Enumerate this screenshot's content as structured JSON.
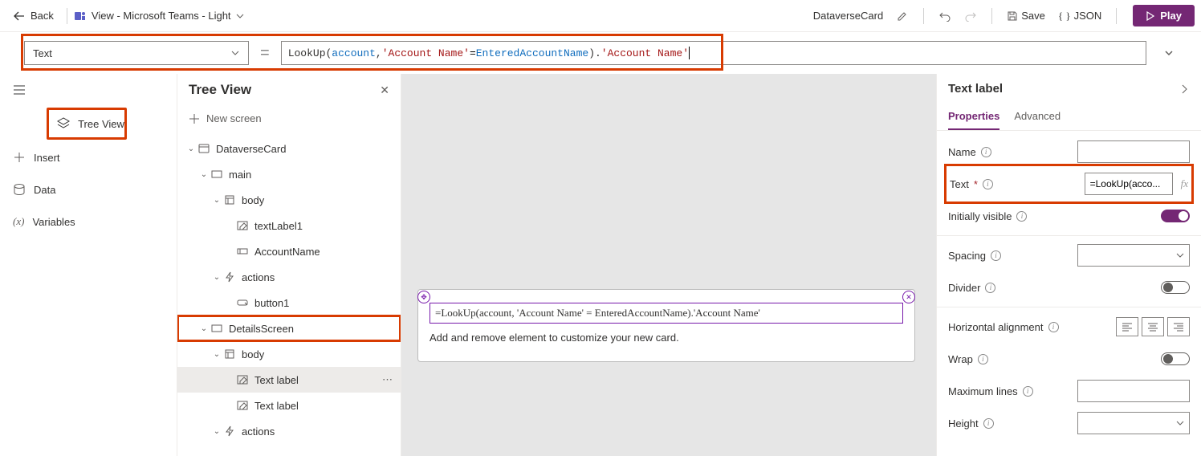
{
  "topbar": {
    "back": "Back",
    "view_label": "View - Microsoft Teams - Light",
    "tab_name": "DataverseCard",
    "save": "Save",
    "json": "JSON",
    "play": "Play"
  },
  "formula": {
    "selected_property": "Text",
    "expression_display": "LookUp(account, 'Account Name' = EnteredAccountName).'Account Name'",
    "tokens": {
      "t1": "LookUp(",
      "t2": "account",
      "t3": ", ",
      "t4": "'Account Name'",
      "t5": " = ",
      "t6": "EnteredAccountName",
      "t7": ").",
      "t8": "'Account Name'"
    }
  },
  "rail": {
    "tree": "Tree View",
    "insert": "Insert",
    "data": "Data",
    "variables": "Variables"
  },
  "tree": {
    "title": "Tree View",
    "new_screen": "New screen",
    "items": [
      {
        "label": "DataverseCard",
        "indent": 0,
        "icon": "card",
        "chev": true
      },
      {
        "label": "main",
        "indent": 1,
        "icon": "rect",
        "chev": true
      },
      {
        "label": "body",
        "indent": 2,
        "icon": "body",
        "chev": true
      },
      {
        "label": "textLabel1",
        "indent": 3,
        "icon": "textedit",
        "chev": false
      },
      {
        "label": "AccountName",
        "indent": 3,
        "icon": "input",
        "chev": false
      },
      {
        "label": "actions",
        "indent": 2,
        "icon": "bolt",
        "chev": true
      },
      {
        "label": "button1",
        "indent": 3,
        "icon": "button",
        "chev": false
      },
      {
        "label": "DetailsScreen",
        "indent": 1,
        "icon": "rect",
        "chev": true,
        "hl": true
      },
      {
        "label": "body",
        "indent": 2,
        "icon": "body",
        "chev": true
      },
      {
        "label": "Text label",
        "indent": 3,
        "icon": "textedit",
        "chev": false,
        "selected": true
      },
      {
        "label": "Text label",
        "indent": 3,
        "icon": "textedit",
        "chev": false
      },
      {
        "label": "actions",
        "indent": 2,
        "icon": "bolt",
        "chev": true
      }
    ]
  },
  "canvas": {
    "selected_text": "=LookUp(account, 'Account Name' = EnteredAccountName).'Account Name'",
    "helper": "Add and remove element to customize your new card."
  },
  "properties": {
    "panel_title": "Text label",
    "tabs": {
      "properties": "Properties",
      "advanced": "Advanced"
    },
    "name_label": "Name",
    "name_value": "",
    "text_label": "Text",
    "text_value": "=LookUp(acco...",
    "initially_visible": "Initially visible",
    "spacing": "Spacing",
    "divider": "Divider",
    "halign": "Horizontal alignment",
    "wrap": "Wrap",
    "maxlines": "Maximum lines",
    "height": "Height"
  }
}
